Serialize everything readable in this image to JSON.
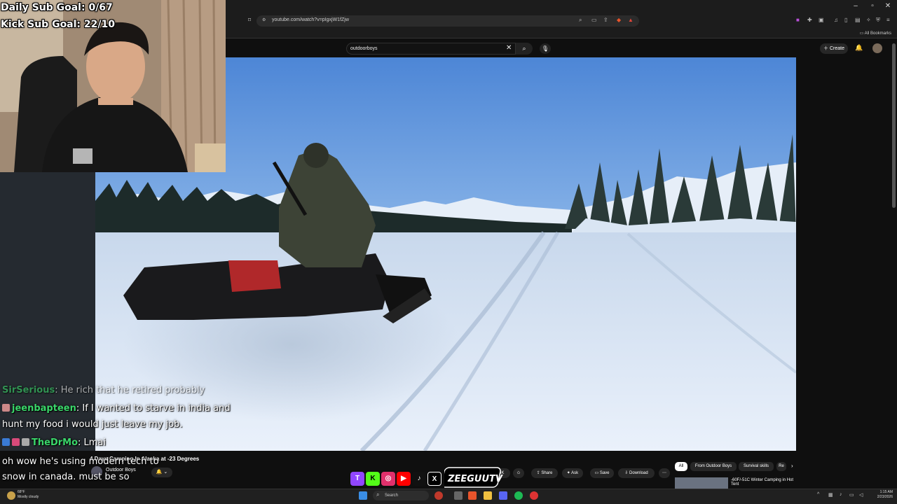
{
  "overlay": {
    "daily_sub_goal": "Daily Sub Goal: 0/67",
    "kick_sub_goal": "Kick Sub Goal: 22/10"
  },
  "browser": {
    "url": "youtube.com/watch?v=pIgxjW1fZjw",
    "all_bookmarks": "All Bookmarks",
    "window_controls": [
      "–",
      "▫",
      "✕"
    ]
  },
  "youtube": {
    "search_value": "outdoorboys",
    "create_label": "Create",
    "video_title": "4 Days Camping In Alaska at -23 Degrees",
    "channel_name": "Outdoor Boys",
    "actions": [
      "Share",
      "Ask",
      "Save",
      "Download"
    ],
    "like_count": "36K",
    "chips": [
      "All",
      "From Outdoor Boys",
      "Survival skills",
      "Re"
    ],
    "recommended_title": "-60F/-51C Winter Camping in Hot Tent"
  },
  "chat": {
    "messages": [
      {
        "user": "SirSerious",
        "text": ": He rich that he retired probably"
      },
      {
        "user": "jeenbapteen",
        "text": ": If I wanted to starve in india and"
      },
      {
        "user": "",
        "text": "hunt my food i would just leave my job."
      },
      {
        "user": "TheDrMo",
        "text": ": Lmai"
      },
      {
        "user": "",
        "text": "oh wow he's using modern tech to"
      },
      {
        "user": "",
        "text": "snow in canada. must be so"
      }
    ]
  },
  "branding": {
    "logo_text": "ZEEGUUTV"
  },
  "taskbar": {
    "weather_temp": "68°F",
    "weather_desc": "Mostly cloudy",
    "search_label": "Search",
    "time": "1:15 AM",
    "date": "2/23/2026"
  },
  "colors": {
    "youtube_red": "#ff0000",
    "chat_username": "#3ad66a",
    "twitch": "#9146ff",
    "kick": "#53fc18",
    "instagram": "#e1306c"
  }
}
